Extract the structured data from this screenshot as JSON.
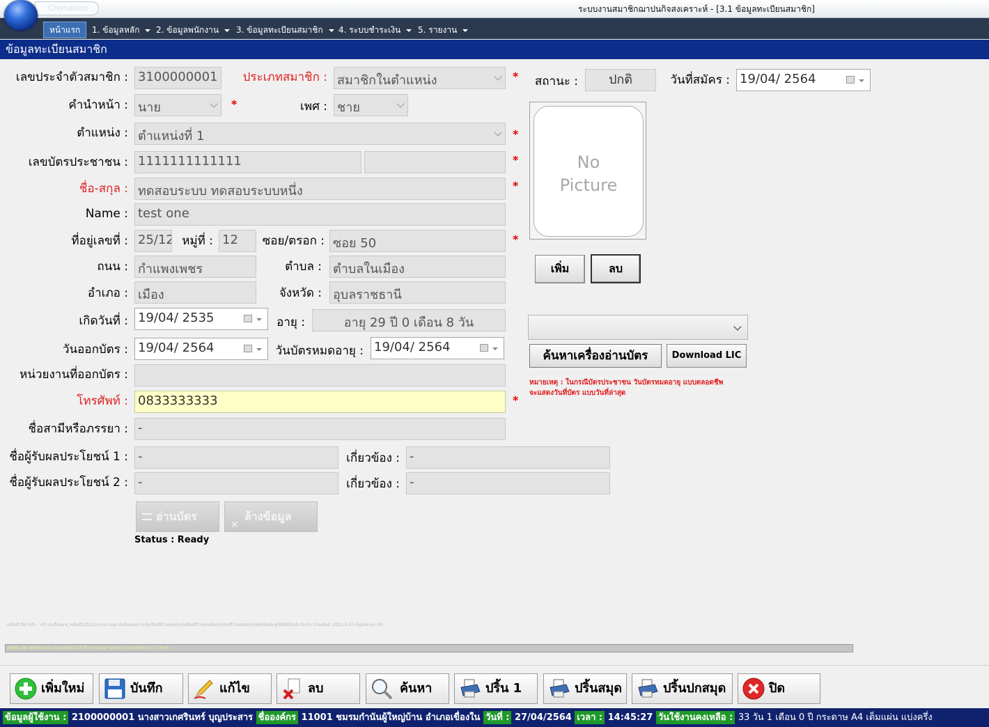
{
  "window": {
    "app_name": "Cremation",
    "title": "ระบบงานสมาชิกฌาปนกิจสงเคราะห์ - [3.1 ข้อมูลทะเบียนสมาชิก]"
  },
  "menu": {
    "home": "หน้าแรก",
    "items": [
      "1. ข้อมูลหลัก",
      "2. ข้อมูลพนักงาน",
      "3. ข้อมูลทะเบียนสมาชิก",
      "4. ระบบชำระเงิน",
      "5. รายงาน"
    ]
  },
  "section_title": "ข้อมูลทะเบียนสมาชิก",
  "form": {
    "member_id": {
      "label": "เลขประจำตัวสมาชิก :",
      "value": "3100000001"
    },
    "member_type": {
      "label": "ประเภทสมาชิก :",
      "value": "สมาชิกในตำแหน่ง"
    },
    "prefix": {
      "label": "คำนำหน้า :",
      "value": "นาย"
    },
    "gender": {
      "label": "เพศ :",
      "value": "ชาย"
    },
    "position": {
      "label": "ตำแหน่ง :",
      "value": "ตำแหน่งที่ 1"
    },
    "citizen_id": {
      "label": "เลขบัตรประชาชน :",
      "value": "1111111111111",
      "extra": ""
    },
    "full_name": {
      "label": "ชื่อ-สกุล :",
      "value": "ทดสอบระบบ ทดสอบระบบหนึ่ง"
    },
    "name_en": {
      "label": "Name :",
      "value": "test one"
    },
    "house_no": {
      "label": "ที่อยู่เลขที่ :",
      "value": "25/12"
    },
    "moo": {
      "label": "หมู่ที่ :",
      "value": "12"
    },
    "soi": {
      "label": "ซอย/ตรอก :",
      "value": "ซอย 50"
    },
    "road": {
      "label": "ถนน :",
      "value": "กำแพงเพชร"
    },
    "tambon": {
      "label": "ตำบล :",
      "value": "ตำบลในเมือง"
    },
    "amphoe": {
      "label": "อำเภอ :",
      "value": "เมือง"
    },
    "province": {
      "label": "จังหวัด :",
      "value": "อุบลราชธานี"
    },
    "birth_date": {
      "label": "เกิดวันที่ :",
      "value": "19/04/  2535"
    },
    "age": {
      "label": "อายุ :",
      "value": "อายุ 29 ปี 0 เดือน 8 วัน"
    },
    "issue_date": {
      "label": "วันออกบัตร :",
      "value": "19/04/  2564"
    },
    "expire_date": {
      "label": "วันบัตรหมดอายุ :",
      "value": "19/04/  2564"
    },
    "issuer": {
      "label": "หน่วยงานที่ออกบัตร :",
      "value": ""
    },
    "phone": {
      "label": "โทรศัพท์ :",
      "value": "0833333333"
    },
    "spouse": {
      "label": "ชื่อสามีหรือภรรยา :",
      "value": "-"
    },
    "beneficiary1": {
      "label": "ชื่อผู้รับผลประโยชน์ 1 :",
      "value": "-",
      "rel_label": "เกี่ยวข้อง :",
      "rel_value": "-"
    },
    "beneficiary2": {
      "label": "ชื่อผู้รับผลประโยชน์ 2 :",
      "value": "-",
      "rel_label": "เกี่ยวข้อง :",
      "rel_value": "-"
    },
    "status": {
      "label": "สถานะ :",
      "value": "ปกติ"
    },
    "apply_date": {
      "label": "วันที่สมัคร :",
      "value": "19/04/  2564"
    },
    "required_mark": "*"
  },
  "photo": {
    "placeholder_line1": "No",
    "placeholder_line2": "Picture",
    "add_label": "เพิ่ม",
    "delete_label": "ลบ"
  },
  "card_reader": {
    "selected": "",
    "find_label": "ค้นหาเครื่องอ่านบัตร",
    "download_label": "Download LIC",
    "note_line1": "หมายเหตุ : ในกรณีบัตรประชาชน วันบัตรหมดอายุ แบบตลอดชีพ",
    "note_line2": "จะแสดงวันที่บัตร แบบวันที่ล่าสุด"
  },
  "actions": {
    "read_card": "อ่านบัตร",
    "clear_data": "ล้างข้อมูล",
    "status_text": "Status : Ready"
  },
  "debug": {
    "path_text": "rdSoft Dll info : <D:\\Software_rdSoft\\2021\\ระบบงานฌาปนกิจสงเคราะห์\\rdSoftCremation\\rdSoftCremation\\rdSoftCremation\\bin\\Debug\\RDNIDLib.DLX> Created :2021-5-20 Expire.no (0)",
    "progress_text": "rdNIDLL.lib: RDNIDLib.DLL Copyright(2017) RD Computer System Co.Ltd Version 2.1.7.20 rel"
  },
  "toolbar": {
    "new": "เพิ่มใหม่",
    "save": "บันทึก",
    "edit": "แก้ไข",
    "delete": "ลบ",
    "search": "ค้นหา",
    "print1": "ปริ้น 1",
    "print_book": "ปริ้นสมุด",
    "print_cover": "ปริ้นปกสมุด",
    "close": "ปิด"
  },
  "statusbar": {
    "user_label": "ข้อมูลผู้ใช้งาน :",
    "user_value": "2100000001  นางสาวเกศรินทร์ บุญประสาร",
    "org_label": "ชื่อองค์กร",
    "org_value": "11001  ชมรมกำนันผู้ใหญ่บ้าน อำเภอเขื่องใน",
    "date_label": "วันที่ :",
    "date_value": "27/04/2564",
    "time_label": "เวลา :",
    "time_value": "14:45:27",
    "remain_label": "วันใช้งานคงเหลือ :",
    "remain_value": "33  วัน  1  เดือน  0  ปี  กระดาษ A4 เต็มแผ่น แบ่งครึ่ง"
  }
}
